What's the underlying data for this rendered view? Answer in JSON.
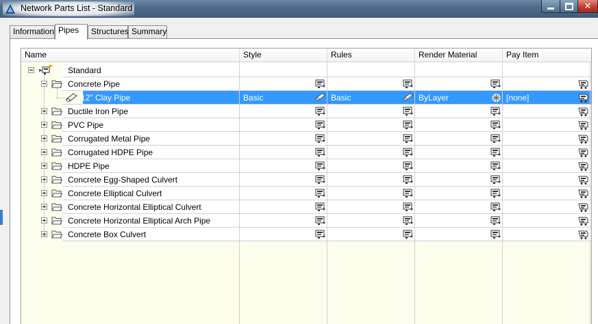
{
  "window": {
    "title": "Network Parts List - Standard"
  },
  "tabs": [
    {
      "label": "Information",
      "active": false
    },
    {
      "label": "Pipes",
      "active": true
    },
    {
      "label": "Structures",
      "active": false
    },
    {
      "label": "Summary",
      "active": false
    }
  ],
  "columns": {
    "name": "Name",
    "style": "Style",
    "rules": "Rules",
    "render_material": "Render Material",
    "pay_item": "Pay Item"
  },
  "tree": {
    "root": "Standard",
    "families": [
      {
        "name": "Concrete Pipe",
        "expanded": true
      },
      {
        "name": "Ductile Iron Pipe",
        "expanded": false
      },
      {
        "name": "PVC Pipe",
        "expanded": false
      },
      {
        "name": "Corrugated Metal Pipe",
        "expanded": false
      },
      {
        "name": "Corrugated HDPE Pipe",
        "expanded": false
      },
      {
        "name": "HDPE Pipe",
        "expanded": false
      },
      {
        "name": "Concrete Egg-Shaped Culvert",
        "expanded": false
      },
      {
        "name": "Concrete Elliptical Culvert",
        "expanded": false
      },
      {
        "name": "Concrete Horizontal Elliptical Culvert",
        "expanded": false
      },
      {
        "name": "Concrete Horizontal Elliptical Arch Pipe",
        "expanded": false
      },
      {
        "name": "Concrete Box Culvert",
        "expanded": false
      }
    ],
    "selected_part": {
      "name": "12\" Clay Pipe",
      "style": "Basic",
      "rules": "Basic",
      "render_material": "ByLayer",
      "pay_item": "[none]"
    }
  },
  "colors": {
    "selection": "#3399ff",
    "grid_bg": "#fdfdee",
    "titlebar": "#4e6c8c"
  },
  "icons": [
    "autocad-logo-icon",
    "parts-list-icon",
    "folder-open-icon",
    "folder-closed-icon",
    "pipe-part-icon",
    "edit-style-icon",
    "pay-item-icon",
    "render-material-icon"
  ]
}
